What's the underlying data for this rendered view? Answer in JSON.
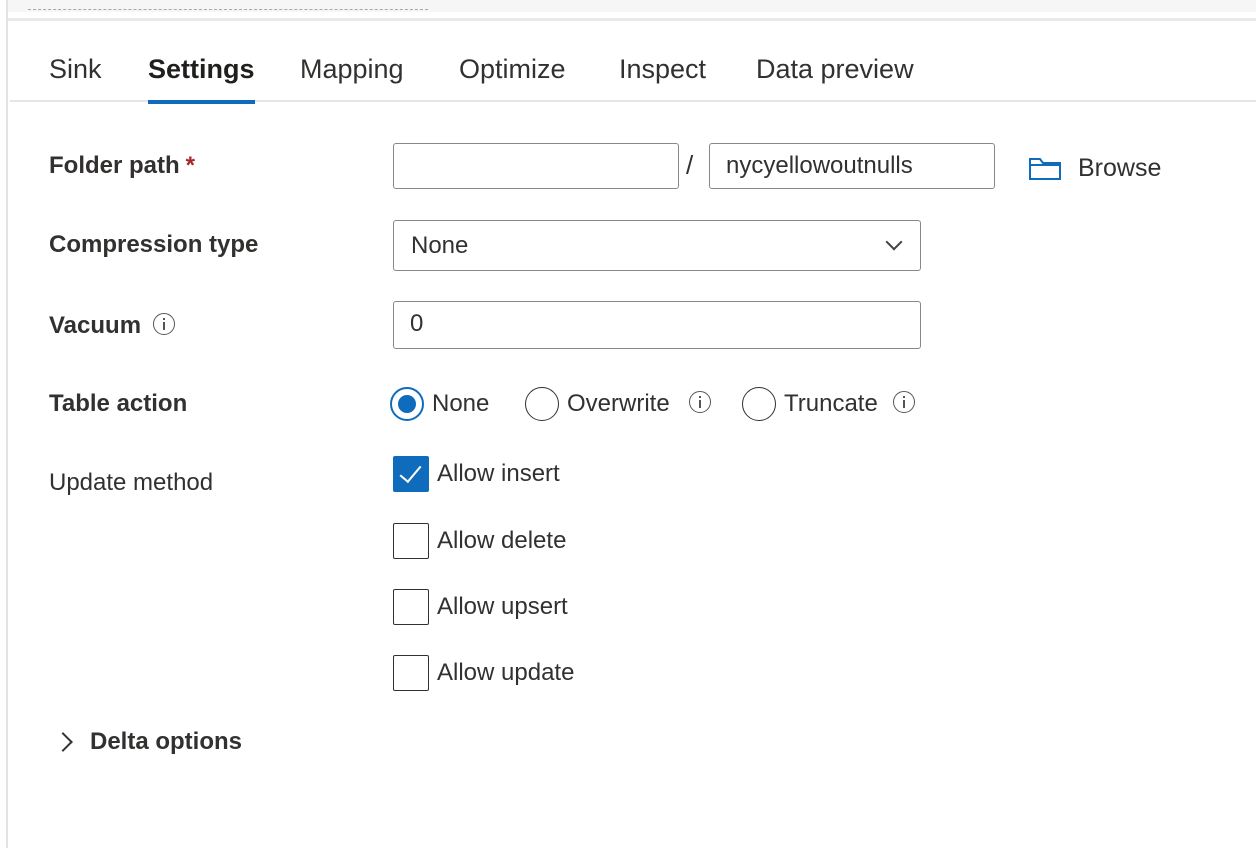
{
  "tabs": [
    {
      "label": "Sink"
    },
    {
      "label": "Settings"
    },
    {
      "label": "Mapping"
    },
    {
      "label": "Optimize"
    },
    {
      "label": "Inspect"
    },
    {
      "label": "Data preview"
    }
  ],
  "active_tab": "Settings",
  "folder_path": {
    "label": "Folder path",
    "required_mark": "*",
    "container_value": "",
    "separator": "/",
    "folder_value": "nycyellowoutnulls",
    "browse_label": "Browse"
  },
  "compression": {
    "label": "Compression type",
    "selected": "None"
  },
  "vacuum": {
    "label": "Vacuum",
    "value": "0"
  },
  "table_action": {
    "label": "Table action",
    "options": [
      {
        "label": "None",
        "checked": true
      },
      {
        "label": "Overwrite",
        "checked": false
      },
      {
        "label": "Truncate",
        "checked": false
      }
    ]
  },
  "update_method": {
    "label": "Update method",
    "options": [
      {
        "label": "Allow insert",
        "checked": true
      },
      {
        "label": "Allow delete",
        "checked": false
      },
      {
        "label": "Allow upsert",
        "checked": false
      },
      {
        "label": "Allow update",
        "checked": false
      }
    ]
  },
  "delta_options": {
    "label": "Delta options"
  },
  "colors": {
    "accent": "#0f6cbd",
    "required": "#a4262c"
  }
}
